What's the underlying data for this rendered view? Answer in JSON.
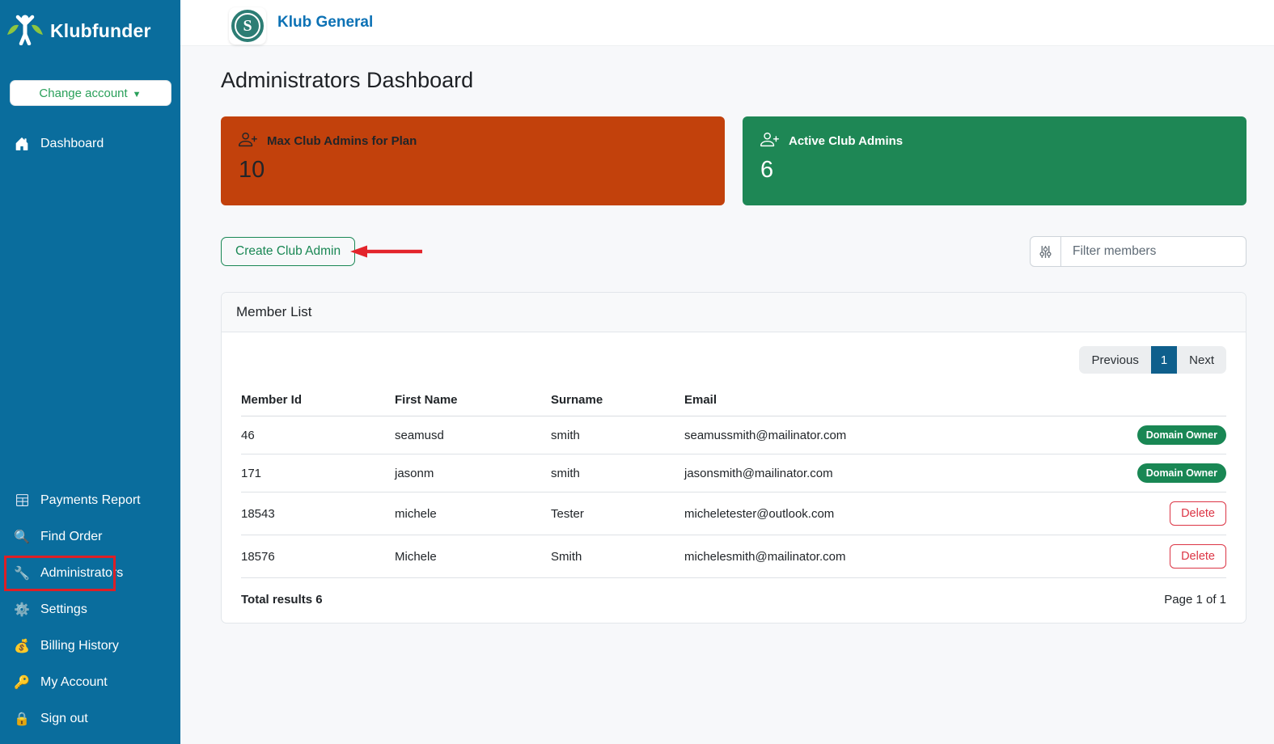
{
  "colors": {
    "sidebar_bg": "#0A6D9D",
    "brand_leaf_green": "#8DC63F",
    "header_link_blue": "#0D72B5",
    "stat_orange": "#C2410C",
    "stat_green": "#1E8755",
    "badge_green": "#198754",
    "delete_red": "#DC3545",
    "annotation_red": "#DE1F26",
    "pagination_active_blue": "#0F5F8C"
  },
  "sidebar": {
    "brand": "Klubfunder",
    "change_account_label": "Change account",
    "nav_top": [
      {
        "label": "Dashboard",
        "icon": "home-icon",
        "char": ""
      }
    ],
    "nav_bottom": [
      {
        "label": "Payments Report",
        "icon": "table-icon",
        "char": ""
      },
      {
        "label": "Find Order",
        "icon": "search-icon",
        "char": "🔍"
      },
      {
        "label": "Administrators",
        "icon": "wrench-icon",
        "char": "🔧",
        "annotated": true
      },
      {
        "label": "Settings",
        "icon": "gear-icon",
        "char": "⚙️"
      },
      {
        "label": "Billing History",
        "icon": "moneybag-icon",
        "char": "💰"
      },
      {
        "label": "My Account",
        "icon": "key-icon",
        "char": "🔑"
      },
      {
        "label": "Sign out",
        "icon": "lock-icon",
        "char": "🔒"
      }
    ]
  },
  "header": {
    "club_name": "Klub General",
    "logo_letter": "S"
  },
  "page": {
    "title": "Administrators Dashboard"
  },
  "stats": [
    {
      "label": "Max Club Admins for Plan",
      "value": "10",
      "icon": "person-plus-icon",
      "bg": "#C2410C"
    },
    {
      "label": "Active Club Admins",
      "value": "6",
      "icon": "person-plus-icon",
      "bg": "#1E8755"
    }
  ],
  "actions": {
    "create_button": "Create Club Admin",
    "filter_placeholder": "Filter members"
  },
  "member_list": {
    "title": "Member List",
    "pagination": {
      "previous": "Previous",
      "current": "1",
      "next": "Next"
    },
    "columns": [
      "Member Id",
      "First Name",
      "Surname",
      "Email"
    ],
    "rows": [
      {
        "member_id": "46",
        "first_name": "seamusd",
        "surname": "smith",
        "email": "seamussmith@mailinator.com",
        "action": {
          "type": "badge",
          "label": "Domain Owner"
        }
      },
      {
        "member_id": "171",
        "first_name": "jasonm",
        "surname": "smith",
        "email": "jasonsmith@mailinator.com",
        "action": {
          "type": "badge",
          "label": "Domain Owner"
        }
      },
      {
        "member_id": "18543",
        "first_name": "michele",
        "surname": "Tester",
        "email": "micheletester@outlook.com",
        "action": {
          "type": "delete",
          "label": "Delete"
        }
      },
      {
        "member_id": "18576",
        "first_name": "Michele",
        "surname": "Smith",
        "email": "michelesmith@mailinator.com",
        "action": {
          "type": "delete",
          "label": "Delete"
        }
      }
    ],
    "footer": {
      "total": "Total results 6",
      "page": "Page 1 of 1"
    }
  }
}
